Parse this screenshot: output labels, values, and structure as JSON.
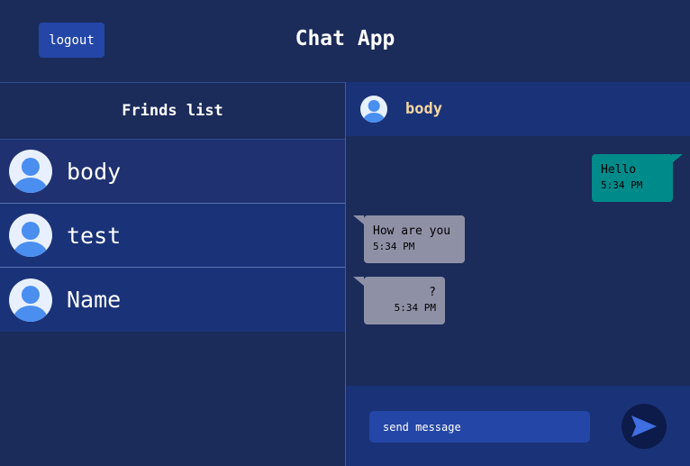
{
  "header": {
    "logout_label": "logout",
    "title": "Chat App"
  },
  "sidebar": {
    "heading": "Frinds list",
    "friends": [
      {
        "name": "body"
      },
      {
        "name": "test"
      },
      {
        "name": "Name"
      }
    ]
  },
  "chat": {
    "contact_name": "body",
    "messages": [
      {
        "text": "Hello",
        "time": "5:34 PM",
        "direction": "sent"
      },
      {
        "text": "How are you",
        "time": "5:34 PM",
        "direction": "received"
      },
      {
        "text": "?",
        "time": "5:34 PM",
        "direction": "received"
      }
    ],
    "composer": {
      "placeholder": "send message"
    }
  },
  "icons": {
    "avatar": "user-avatar-icon",
    "send": "send-arrow-icon"
  },
  "colors": {
    "background": "#1b2b5a",
    "panel": "#1a3278",
    "accent": "#2446a7",
    "sent_bubble": "#008b8b",
    "received_bubble": "#8e91a6",
    "contact_name": "#f5d7a1",
    "avatar_blue": "#4a8ef0"
  }
}
